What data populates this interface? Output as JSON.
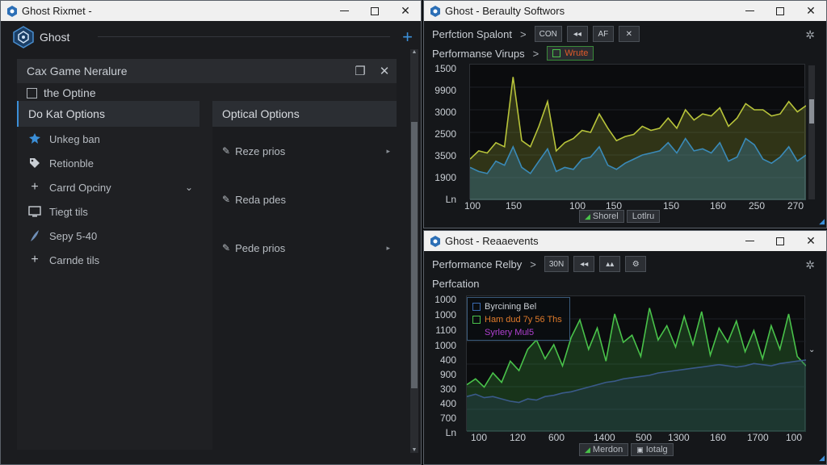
{
  "window_a": {
    "title": "Ghost Rixmet -",
    "app_name": "Ghost",
    "subheader": "Cax Game Neralure",
    "option_row": "the Optine",
    "selected_item": "Do Kat Options",
    "menu": [
      {
        "label": "Unkeg ban",
        "icon": "puzzle-icon"
      },
      {
        "label": "Retionble",
        "icon": "tag-icon"
      },
      {
        "label": "Carrd Opciny",
        "icon": "plus-icon",
        "chevron": true
      },
      {
        "label": "Tiegt tils",
        "icon": "monitor-icon"
      },
      {
        "label": "Sepy 5-40",
        "icon": "feather-icon"
      },
      {
        "label": "Carnde tils",
        "icon": "plus-icon"
      }
    ],
    "optical_header": "Optical Options",
    "optical_items": [
      {
        "label": "Reze prios",
        "arrow": true
      },
      {
        "label": "Reda pdes",
        "arrow": false
      },
      {
        "label": "Pede prios",
        "arrow": true
      }
    ]
  },
  "window_b": {
    "title": "Ghost - Beraulty Softwors",
    "row1_label": "Perfction Spalont",
    "row1_buttons": [
      "CON",
      "◂◂",
      "AF",
      "✕"
    ],
    "row2_label": "Performanse Virups",
    "row2_tag": "Wrute",
    "chart_legend_buttons": [
      "Shorel",
      "Lotlru"
    ]
  },
  "window_c": {
    "title": "Ghost - Reaaevents",
    "row1_label": "Performance Relby",
    "row1_buttons": [
      "30N",
      "◂◂",
      "▴▴",
      "⚙"
    ],
    "subtitle": "Perfcation",
    "legend": [
      {
        "label": "Byrcining Bel",
        "color": "#3a6ab0"
      },
      {
        "label": "Ham dud 7y 56 Ths",
        "color": "#49c24a"
      },
      {
        "label": "Syrlery Mul5",
        "color": "#b040d0"
      }
    ],
    "chart_legend_buttons": [
      "Merdon",
      "Iotalg"
    ]
  },
  "colors": {
    "accent": "#3b8fd8",
    "yellow_series": "#b8c43a",
    "blue_series": "#3a8ab8",
    "green_series": "#49c24a"
  },
  "chart_data": [
    {
      "type": "area",
      "y_tick_labels": [
        "1500",
        "9900",
        "3000",
        "2500",
        "3500",
        "1900",
        "Ln"
      ],
      "x_tick_labels": [
        "100",
        "150",
        "100",
        "150",
        "150",
        "160",
        "250",
        "270"
      ],
      "series": [
        {
          "values": [
            2500,
            2700,
            2650,
            2900,
            2800,
            4500,
            2950,
            2800,
            3300,
            3900,
            2700,
            2900,
            3000,
            3200,
            3150,
            3600,
            3250,
            2950,
            3050,
            3100,
            3300,
            3200,
            3250,
            3500,
            3250,
            3700,
            3450,
            3600,
            3550,
            3750,
            3300,
            3500,
            3850,
            3700,
            3700,
            3550,
            3600,
            3900,
            3650,
            3800
          ]
        },
        {
          "values": [
            2300,
            2200,
            2150,
            2450,
            2350,
            2800,
            2300,
            2150,
            2450,
            2750,
            2200,
            2300,
            2250,
            2500,
            2550,
            2800,
            2350,
            2250,
            2400,
            2500,
            2600,
            2650,
            2700,
            2900,
            2650,
            3000,
            2700,
            2750,
            2650,
            2900,
            2450,
            2550,
            3000,
            2850,
            2500,
            2400,
            2550,
            2800,
            2450,
            2600
          ]
        }
      ]
    },
    {
      "type": "area",
      "y_tick_labels": [
        "1000",
        "1000",
        "1100",
        "1000",
        "400",
        "900",
        "300",
        "400",
        "700",
        "Ln"
      ],
      "x_tick_labels": [
        "100",
        "120",
        "600",
        "1400",
        "500",
        "1300",
        "160",
        "1700",
        "100"
      ],
      "series": [
        {
          "values": [
            400,
            450,
            380,
            500,
            420,
            600,
            520,
            700,
            780,
            620,
            740,
            560,
            800,
            950,
            700,
            880,
            600,
            1000,
            760,
            820,
            640,
            1050,
            780,
            900,
            720,
            980,
            740,
            1020,
            650,
            880,
            760,
            940,
            680,
            860,
            620,
            900,
            700,
            1000,
            640,
            560
          ]
        },
        {
          "values": [
            300,
            320,
            290,
            300,
            280,
            260,
            250,
            280,
            270,
            300,
            310,
            330,
            340,
            360,
            380,
            400,
            420,
            430,
            450,
            460,
            470,
            480,
            500,
            510,
            520,
            530,
            540,
            550,
            560,
            570,
            560,
            550,
            560,
            580,
            570,
            560,
            580,
            590,
            600,
            610
          ]
        }
      ]
    }
  ]
}
